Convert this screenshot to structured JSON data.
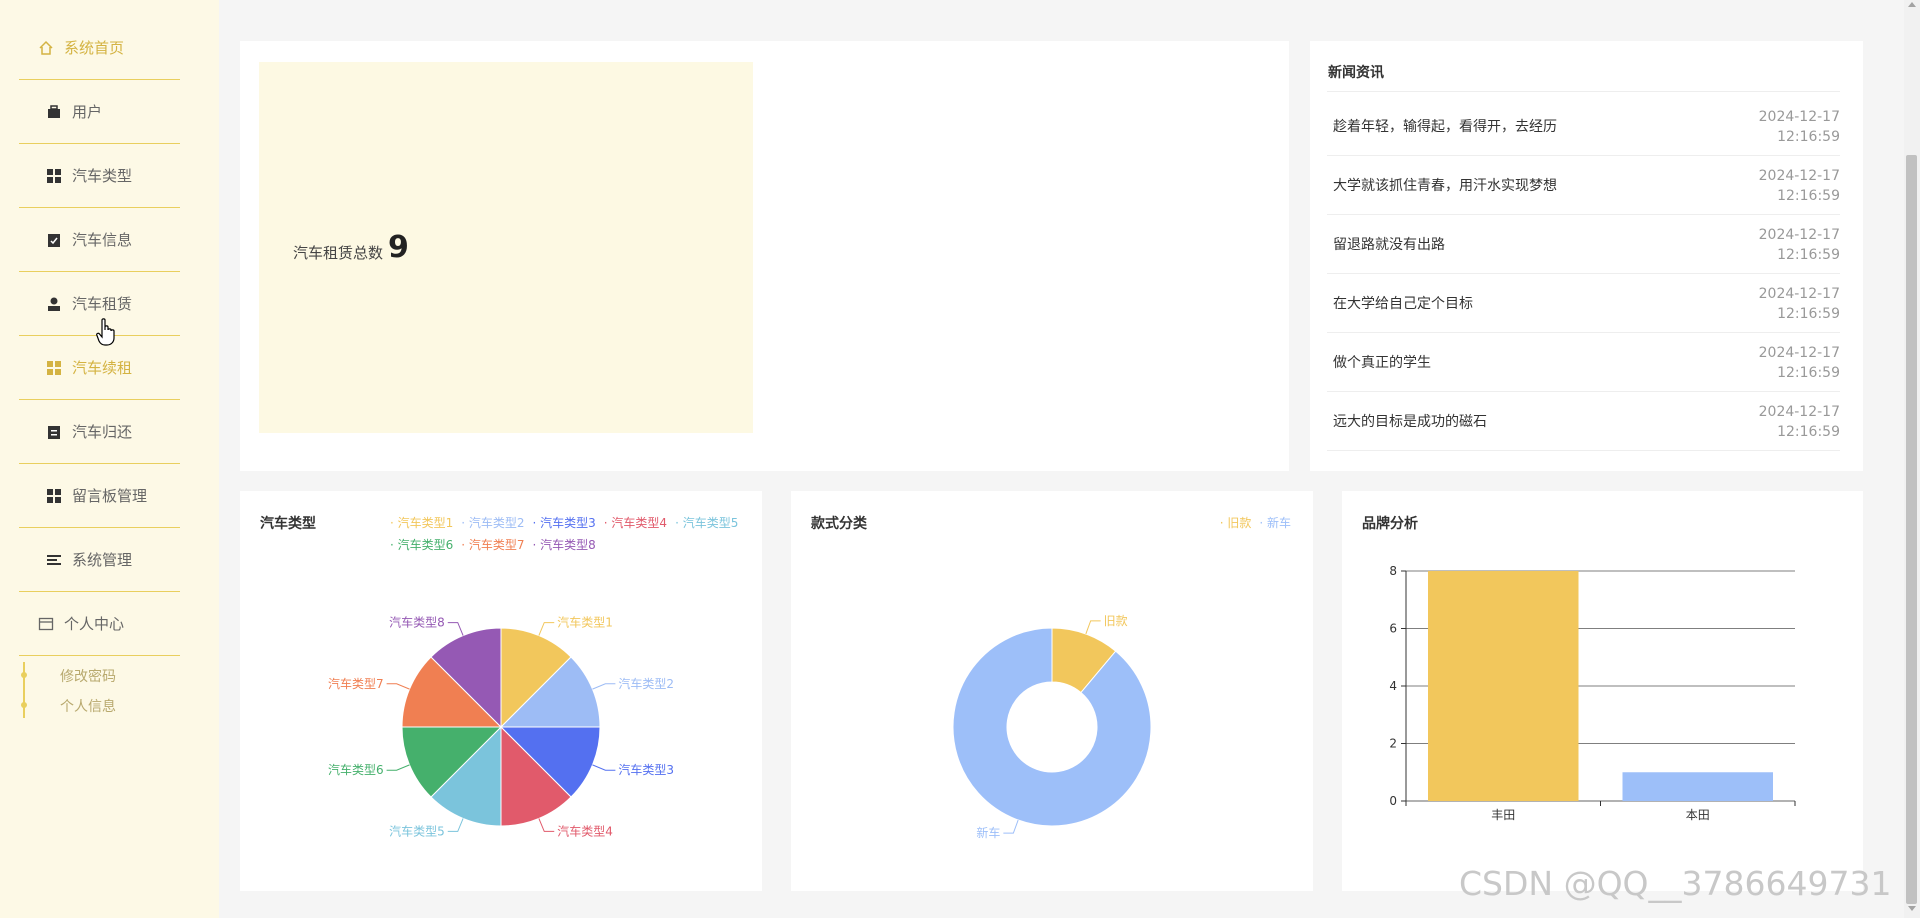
{
  "colors": {
    "accent": "#e9cf5e",
    "sidebar_bg": "#fdf9e6",
    "stat_bg": "#fdf9e3"
  },
  "sidebar": {
    "home": {
      "label": "系统首页",
      "icon": "home-icon"
    },
    "items": [
      {
        "label": "用户",
        "icon": "briefcase-icon"
      },
      {
        "label": "汽车类型",
        "icon": "grid-icon"
      },
      {
        "label": "汽车信息",
        "icon": "clipboard-check-icon"
      },
      {
        "label": "汽车租赁",
        "icon": "person-icon"
      },
      {
        "label": "汽车续租",
        "icon": "grid-icon"
      },
      {
        "label": "汽车归还",
        "icon": "clipboard-icon"
      },
      {
        "label": "留言板管理",
        "icon": "grid-icon"
      },
      {
        "label": "系统管理",
        "icon": "menu-icon"
      }
    ],
    "personal": {
      "label": "个人中心",
      "icon": "window-icon"
    },
    "sub": [
      "修改密码",
      "个人信息"
    ]
  },
  "stat": {
    "label": "汽车租赁总数",
    "value": "9"
  },
  "news": {
    "title": "新闻资讯",
    "items": [
      {
        "title": "趁着年轻，输得起，看得开，去经历",
        "date": "2024-12-17",
        "time": "12:16:59"
      },
      {
        "title": "大学就该抓住青春，用汗水实现梦想",
        "date": "2024-12-17",
        "time": "12:16:59"
      },
      {
        "title": "留退路就没有出路",
        "date": "2024-12-17",
        "time": "12:16:59"
      },
      {
        "title": "在大学给自己定个目标",
        "date": "2024-12-17",
        "time": "12:16:59"
      },
      {
        "title": "做个真正的学生",
        "date": "2024-12-17",
        "time": "12:16:59"
      },
      {
        "title": "远大的目标是成功的磁石",
        "date": "2024-12-17",
        "time": "12:16:59"
      }
    ]
  },
  "watermark": "CSDN @QQ__3786649731",
  "chart_data": [
    {
      "type": "pie",
      "title": "汽车类型",
      "categories": [
        "汽车类型1",
        "汽车类型2",
        "汽车类型3",
        "汽车类型4",
        "汽车类型5",
        "汽车类型6",
        "汽车类型7",
        "汽车类型8"
      ],
      "values": [
        1,
        1,
        1,
        1,
        1,
        1,
        1,
        1
      ],
      "colors": [
        "#f2c75c",
        "#9dbcf5",
        "#5470f0",
        "#e15a6b",
        "#7bc4dc",
        "#45b06c",
        "#f07f52",
        "#9559b4"
      ],
      "legend": "top-right"
    },
    {
      "type": "pie",
      "title": "款式分类",
      "categories": [
        "旧款",
        "新车"
      ],
      "values": [
        1,
        8
      ],
      "colors": [
        "#f2c75c",
        "#9dbff9"
      ],
      "donut": true,
      "legend": "top-right"
    },
    {
      "type": "bar",
      "title": "品牌分析",
      "categories": [
        "丰田",
        "本田"
      ],
      "values": [
        8,
        1
      ],
      "colors": [
        "#f2c75c",
        "#9dbff9"
      ],
      "ylim": [
        0,
        8
      ],
      "yticks": [
        "0",
        "2",
        "4",
        "6",
        "8"
      ],
      "grid": true
    }
  ]
}
